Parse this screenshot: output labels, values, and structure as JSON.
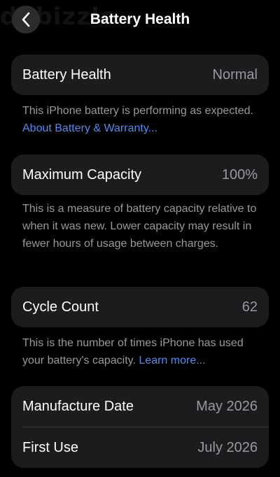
{
  "watermark": "dubizzle",
  "nav": {
    "title": "Battery Health",
    "back_icon": "chevron-left-icon"
  },
  "battery_health": {
    "label": "Battery Health",
    "value": "Normal",
    "note": "This iPhone battery is performing as expected.",
    "link": "About Battery & Warranty..."
  },
  "max_capacity": {
    "label": "Maximum Capacity",
    "value": "100%",
    "note": "This is a measure of battery capacity relative to when it was new. Lower capacity may result in fewer hours of usage between charges."
  },
  "cycle_count": {
    "label": "Cycle Count",
    "value": "62",
    "note": "This is the number of times iPhone has used your battery's capacity.",
    "link": "Learn more..."
  },
  "dates": {
    "manufacture_label": "Manufacture Date",
    "manufacture_value": "May 2026",
    "first_use_label": "First Use",
    "first_use_value": "July 2026"
  },
  "colors": {
    "background": "#000000",
    "card": "#1c1c1e",
    "secondary_text": "#98989e",
    "link": "#4c8df6"
  }
}
